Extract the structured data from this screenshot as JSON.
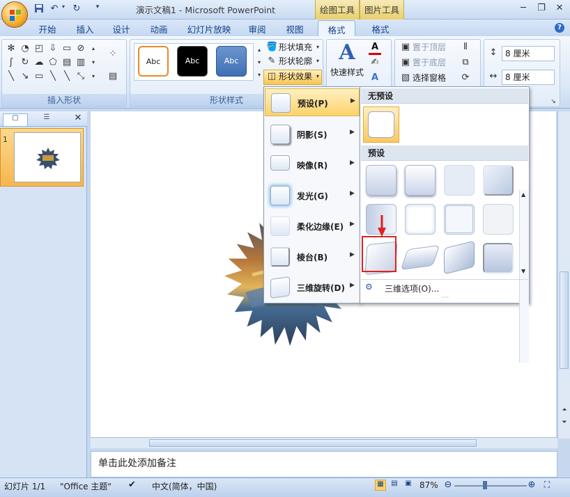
{
  "title_bar": {
    "document_title": "演示文稿1 - Microsoft PowerPoint",
    "context_tool_drawing": "绘图工具",
    "context_tool_picture": "图片工具",
    "qat_icons": [
      "save-icon",
      "undo-icon",
      "redo-icon",
      "customize-icon"
    ]
  },
  "tabs": [
    "开始",
    "插入",
    "设计",
    "动画",
    "幻灯片放映",
    "审阅",
    "视图",
    "格式",
    "格式"
  ],
  "ribbon": {
    "group_insert_shapes": "插入形状",
    "group_shape_styles": "形状样式",
    "style_samples": [
      "Abc",
      "Abc",
      "Abc"
    ],
    "shape_fill": "形状填充",
    "shape_outline": "形状轮廓",
    "shape_effects": "形状效果",
    "quick_styles": "快速样式",
    "bring_to_front": "置于顶层",
    "send_to_back": "置于底层",
    "selection_pane": "选择窗格",
    "height_value": "8 厘米",
    "width_value": "8 厘米"
  },
  "effects_menu": {
    "items": [
      {
        "label": "预设(P)",
        "active": true
      },
      {
        "label": "阴影(S)",
        "active": false
      },
      {
        "label": "映像(R)",
        "active": false
      },
      {
        "label": "发光(G)",
        "active": false
      },
      {
        "label": "柔化边缘(E)",
        "active": false
      },
      {
        "label": "棱台(B)",
        "active": false
      },
      {
        "label": "三维旋转(D)",
        "active": false
      }
    ]
  },
  "preset_panel": {
    "no_preset_header": "无预设",
    "preset_header": "预设",
    "footer_option": "三维选项(O)..."
  },
  "slide_panel": {
    "slide_number": "1"
  },
  "notes": {
    "placeholder": "单击此处添加备注"
  },
  "status_bar": {
    "slide_info": "幻灯片 1/1",
    "theme": "\"Office 主题\"",
    "language": "中文(简体，中国)",
    "zoom": "87%"
  },
  "colors": {
    "accent_active": "#fcd26a",
    "highlight_box": "#e02020",
    "ribbon_blue": "#15428b"
  }
}
